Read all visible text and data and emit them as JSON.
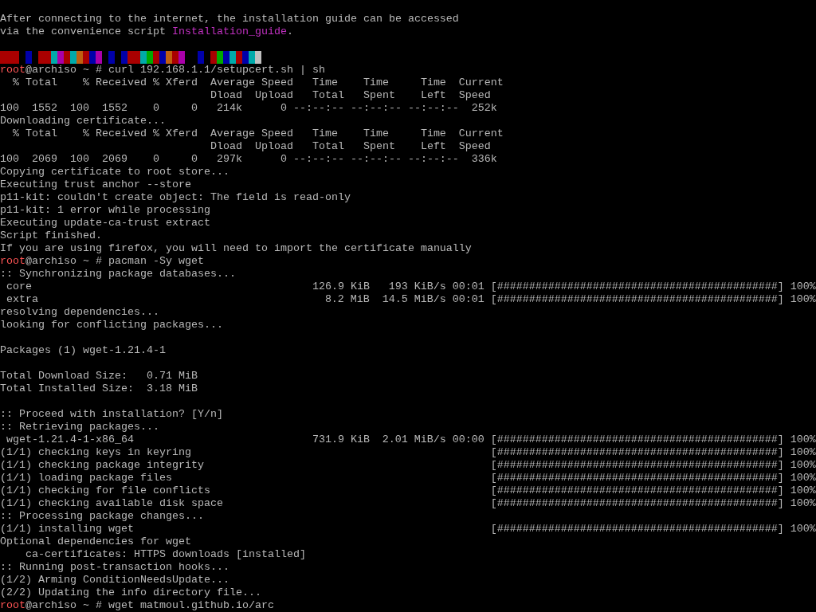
{
  "terminal": {
    "lines": [
      {
        "kind": "blank"
      },
      {
        "kind": "text",
        "segments": [
          {
            "kind": "text",
            "text": "After connecting to the internet, the installation guide can be accessed"
          }
        ]
      },
      {
        "kind": "text",
        "segments": [
          {
            "kind": "text",
            "text": "via the convenience script "
          },
          {
            "kind": "link",
            "text": "Installation_guide"
          },
          {
            "kind": "text",
            "text": "."
          }
        ]
      },
      {
        "kind": "blank"
      },
      {
        "kind": "color_strip"
      },
      {
        "kind": "text",
        "segments": [
          {
            "kind": "user",
            "text": "root"
          },
          {
            "kind": "text",
            "text": "@archiso ~ # curl 192.168.1.1/setupcert.sh | sh"
          }
        ]
      },
      {
        "kind": "text",
        "segments": [
          {
            "kind": "text",
            "text": "  % Total    % Received % Xferd  Average Speed   Time    Time     Time  Current"
          }
        ]
      },
      {
        "kind": "text",
        "segments": [
          {
            "kind": "text",
            "text": "                                 Dload  Upload   Total   Spent    Left  Speed"
          }
        ]
      },
      {
        "kind": "text",
        "segments": [
          {
            "kind": "text",
            "text": "100  1552  100  1552    0     0   214k      0 --:--:-- --:--:-- --:--:--  252k"
          }
        ]
      },
      {
        "kind": "text",
        "segments": [
          {
            "kind": "text",
            "text": "Downloading certificate..."
          }
        ]
      },
      {
        "kind": "text",
        "segments": [
          {
            "kind": "text",
            "text": "  % Total    % Received % Xferd  Average Speed   Time    Time     Time  Current"
          }
        ]
      },
      {
        "kind": "text",
        "segments": [
          {
            "kind": "text",
            "text": "                                 Dload  Upload   Total   Spent    Left  Speed"
          }
        ]
      },
      {
        "kind": "text",
        "segments": [
          {
            "kind": "text",
            "text": "100  2069  100  2069    0     0   297k      0 --:--:-- --:--:-- --:--:--  336k"
          }
        ]
      },
      {
        "kind": "text",
        "segments": [
          {
            "kind": "text",
            "text": "Copying certificate to root store..."
          }
        ]
      },
      {
        "kind": "text",
        "segments": [
          {
            "kind": "text",
            "text": "Executing trust anchor --store"
          }
        ]
      },
      {
        "kind": "text",
        "segments": [
          {
            "kind": "text",
            "text": "p11-kit: couldn't create object: The field is read-only"
          }
        ]
      },
      {
        "kind": "text",
        "segments": [
          {
            "kind": "text",
            "text": "p11-kit: 1 error while processing"
          }
        ]
      },
      {
        "kind": "text",
        "segments": [
          {
            "kind": "text",
            "text": "Executing update-ca-trust extract"
          }
        ]
      },
      {
        "kind": "text",
        "segments": [
          {
            "kind": "text",
            "text": "Script finished."
          }
        ]
      },
      {
        "kind": "text",
        "segments": [
          {
            "kind": "text",
            "text": "If you are using firefox, you will need to import the certificate manually"
          }
        ]
      },
      {
        "kind": "text",
        "segments": [
          {
            "kind": "user",
            "text": "root"
          },
          {
            "kind": "text",
            "text": "@archiso ~ # pacman -Sy wget"
          }
        ]
      },
      {
        "kind": "text",
        "segments": [
          {
            "kind": "text",
            "text": ":: Synchronizing package databases..."
          }
        ]
      },
      {
        "kind": "progress",
        "label": " core",
        "size": "126.9 KiB",
        "speed": "193 KiB/s",
        "eta": "00:01",
        "bar": "[############################################]",
        "percent": "100%"
      },
      {
        "kind": "progress",
        "label": " extra",
        "size": "8.2 MiB",
        "speed": "14.5 MiB/s",
        "eta": "00:01",
        "bar": "[############################################]",
        "percent": "100%"
      },
      {
        "kind": "text",
        "segments": [
          {
            "kind": "text",
            "text": "resolving dependencies..."
          }
        ]
      },
      {
        "kind": "text",
        "segments": [
          {
            "kind": "text",
            "text": "looking for conflicting packages..."
          }
        ]
      },
      {
        "kind": "blank"
      },
      {
        "kind": "text",
        "segments": [
          {
            "kind": "text",
            "text": "Packages (1) wget-1.21.4-1"
          }
        ]
      },
      {
        "kind": "blank"
      },
      {
        "kind": "text",
        "segments": [
          {
            "kind": "text",
            "text": "Total Download Size:   0.71 MiB"
          }
        ]
      },
      {
        "kind": "text",
        "segments": [
          {
            "kind": "text",
            "text": "Total Installed Size:  3.18 MiB"
          }
        ]
      },
      {
        "kind": "blank"
      },
      {
        "kind": "text",
        "segments": [
          {
            "kind": "text",
            "text": ":: Proceed with installation? [Y/n]"
          }
        ]
      },
      {
        "kind": "text",
        "segments": [
          {
            "kind": "text",
            "text": ":: Retrieving packages..."
          }
        ]
      },
      {
        "kind": "progress",
        "label": " wget-1.21.4-1-x86_64",
        "size": "731.9 KiB",
        "speed": "2.01 MiB/s",
        "eta": "00:00",
        "bar": "[############################################]",
        "percent": "100%"
      },
      {
        "kind": "progress",
        "label": "(1/1) checking keys in keyring",
        "bar": "[############################################]",
        "percent": "100%"
      },
      {
        "kind": "progress",
        "label": "(1/1) checking package integrity",
        "bar": "[############################################]",
        "percent": "100%"
      },
      {
        "kind": "progress",
        "label": "(1/1) loading package files",
        "bar": "[############################################]",
        "percent": "100%"
      },
      {
        "kind": "progress",
        "label": "(1/1) checking for file conflicts",
        "bar": "[############################################]",
        "percent": "100%"
      },
      {
        "kind": "progress",
        "label": "(1/1) checking available disk space",
        "bar": "[############################################]",
        "percent": "100%"
      },
      {
        "kind": "text",
        "segments": [
          {
            "kind": "text",
            "text": ":: Processing package changes..."
          }
        ]
      },
      {
        "kind": "progress",
        "label": "(1/1) installing wget",
        "bar": "[############################################]",
        "percent": "100%"
      },
      {
        "kind": "text",
        "segments": [
          {
            "kind": "text",
            "text": "Optional dependencies for wget"
          }
        ]
      },
      {
        "kind": "text",
        "segments": [
          {
            "kind": "text",
            "text": "    ca-certificates: HTTPS downloads [installed]"
          }
        ]
      },
      {
        "kind": "text",
        "segments": [
          {
            "kind": "text",
            "text": ":: Running post-transaction hooks..."
          }
        ]
      },
      {
        "kind": "text",
        "segments": [
          {
            "kind": "text",
            "text": "(1/2) Arming ConditionNeedsUpdate..."
          }
        ]
      },
      {
        "kind": "text",
        "segments": [
          {
            "kind": "text",
            "text": "(2/2) Updating the info directory file..."
          }
        ]
      },
      {
        "kind": "text",
        "segments": [
          {
            "kind": "user",
            "text": "root"
          },
          {
            "kind": "text",
            "text": "@archiso ~ # wget matmoul.github.io/arc"
          }
        ]
      }
    ]
  }
}
